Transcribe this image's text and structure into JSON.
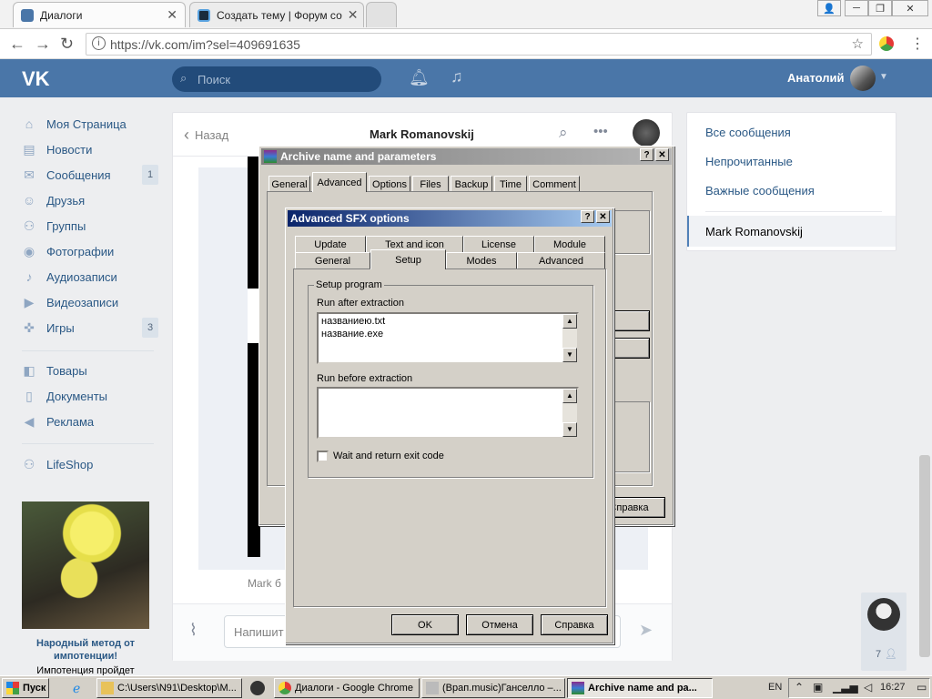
{
  "browser": {
    "tabs": [
      {
        "title": "Диалоги",
        "icon": "vk-favicon"
      },
      {
        "title": "Создать тему | Форум со",
        "icon": "forum-favicon"
      }
    ],
    "url": "https://vk.com/im?sel=409691635"
  },
  "vk": {
    "search_placeholder": "Поиск",
    "user_name": "Анатолий",
    "nav": [
      {
        "label": "Моя Страница",
        "icon": "home-icon"
      },
      {
        "label": "Новости",
        "icon": "news-icon"
      },
      {
        "label": "Сообщения",
        "icon": "messages-icon",
        "count": "1"
      },
      {
        "label": "Друзья",
        "icon": "friends-icon"
      },
      {
        "label": "Группы",
        "icon": "groups-icon"
      },
      {
        "label": "Фотографии",
        "icon": "camera-icon"
      },
      {
        "label": "Аудиозаписи",
        "icon": "music-icon"
      },
      {
        "label": "Видеозаписи",
        "icon": "video-icon"
      },
      {
        "label": "Игры",
        "icon": "gamepad-icon",
        "count": "3"
      },
      {
        "label": "Товары",
        "icon": "bag-icon"
      },
      {
        "label": "Документы",
        "icon": "document-icon"
      },
      {
        "label": "Реклама",
        "icon": "megaphone-icon"
      },
      {
        "label": "LifeShop",
        "icon": "people-icon"
      }
    ],
    "ad": {
      "line1": "Народный метод от",
      "line2": "импотенции!",
      "line3": "Импотенция пройдет"
    },
    "chat": {
      "back_label": "Назад",
      "contact_name": "Mark Romanovskij",
      "msg_preview": "Mark б",
      "input_placeholder": "Напишит"
    },
    "right_menu": [
      {
        "label": "Все сообщения"
      },
      {
        "label": "Непрочитанные"
      },
      {
        "label": "Важные сообщения"
      },
      {
        "label": "Mark Romanovskij"
      }
    ],
    "online_count": "7"
  },
  "archive_dialog": {
    "title": "Archive name and parameters",
    "tabs": [
      "General",
      "Advanced",
      "Options",
      "Files",
      "Backup",
      "Time",
      "Comment"
    ],
    "active_tab": "Advanced",
    "help_button": "Справка"
  },
  "sfx_dialog": {
    "title": "Advanced SFX options",
    "tabs_row1": [
      "Update",
      "Text and icon",
      "License",
      "Module"
    ],
    "tabs_row2": [
      "General",
      "Setup",
      "Modes",
      "Advanced"
    ],
    "active_tab": "Setup",
    "group_label": "Setup program",
    "run_after_label": "Run after extraction",
    "run_after_lines": [
      "названиею.txt",
      "название.exe"
    ],
    "run_before_label": "Run before extraction",
    "wait_label": "Wait and return exit code",
    "ok_button": "OK",
    "cancel_button": "Отмена",
    "help_button": "Справка"
  },
  "taskbar": {
    "start_label": "Пуск",
    "items": [
      {
        "label": "C:\\Users\\N91\\Desktop\\M..."
      },
      {
        "label": "Диалоги - Google Chrome"
      },
      {
        "label": "(Врап.music)Ганселло –..."
      },
      {
        "label": "Archive name and pa..."
      }
    ],
    "lang": "EN",
    "clock": "16:27"
  }
}
